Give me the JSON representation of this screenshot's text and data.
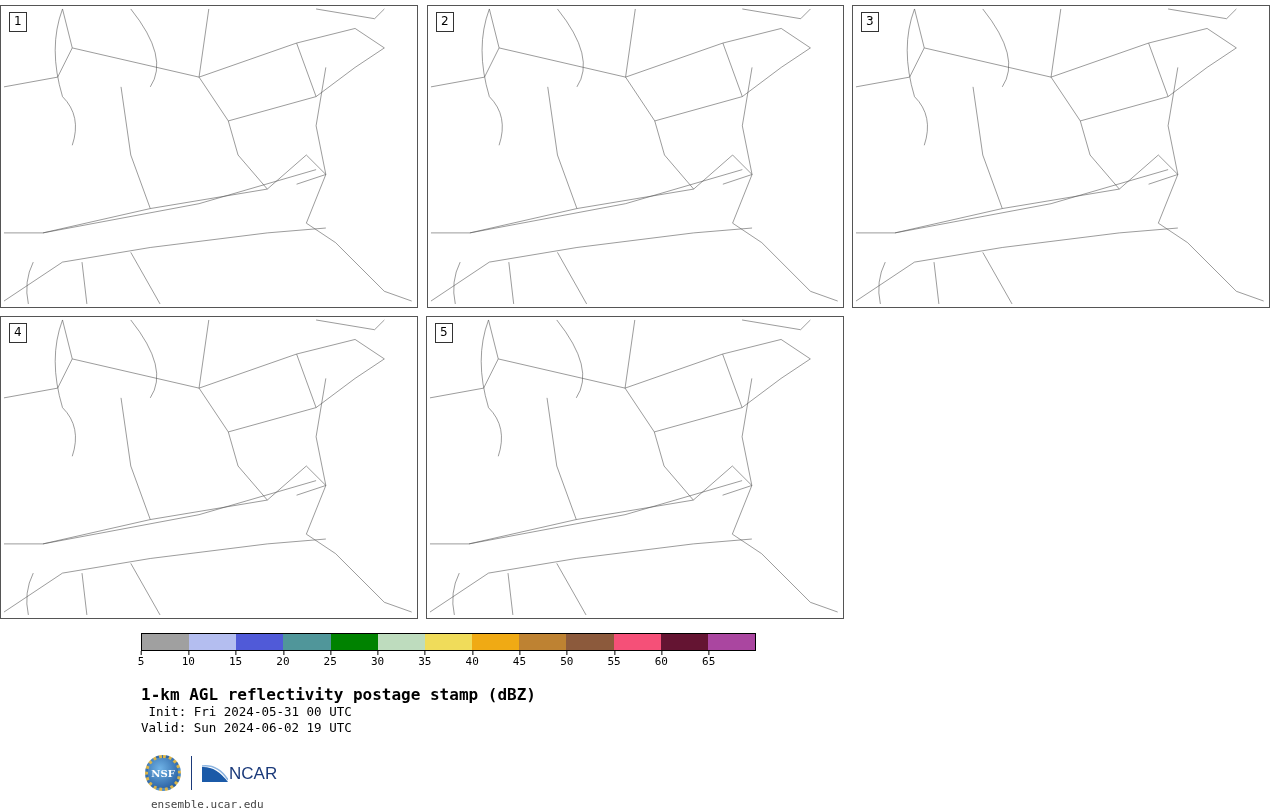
{
  "panels": [
    {
      "number": "1"
    },
    {
      "number": "2"
    },
    {
      "number": "3"
    },
    {
      "number": "4"
    },
    {
      "number": "5"
    }
  ],
  "colorbar": {
    "segments": [
      {
        "color": "#a0a0a0"
      },
      {
        "color": "#b4bef0"
      },
      {
        "color": "#505ad8"
      },
      {
        "color": "#50969a"
      },
      {
        "color": "#008200"
      },
      {
        "color": "#bedcbe"
      },
      {
        "color": "#f0dc5a"
      },
      {
        "color": "#f0aa14"
      },
      {
        "color": "#be8232"
      },
      {
        "color": "#8c5a3c"
      },
      {
        "color": "#f55078"
      },
      {
        "color": "#641432"
      },
      {
        "color": "#aa46a0"
      }
    ],
    "ticks": [
      "5",
      "10",
      "15",
      "20",
      "25",
      "30",
      "35",
      "40",
      "45",
      "50",
      "55",
      "60",
      "65"
    ]
  },
  "title": "1-km AGL reflectivity postage stamp (dBZ)",
  "init": " Init: Fri 2024-05-31 00 UTC",
  "valid": "Valid: Sun 2024-06-02 19 UTC",
  "logos": {
    "nsf": "NSF",
    "ncar": "NCAR"
  },
  "footer": "ensemble.ucar.edu"
}
